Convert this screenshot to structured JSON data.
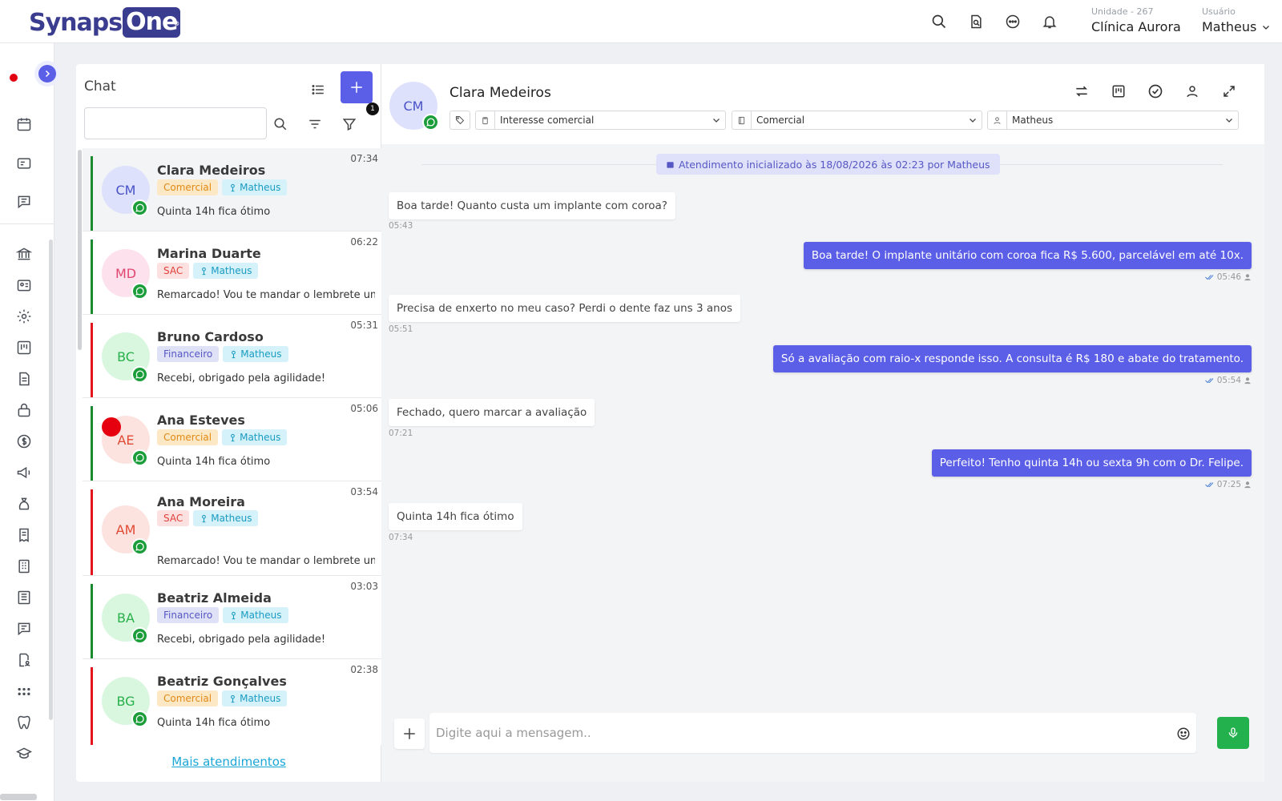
{
  "app": {
    "logo_part1": "Synaps",
    "logo_part2": "One",
    "logo_mark": "®"
  },
  "header": {
    "unit_label": "Unidade - 267",
    "unit_name": "Clínica Aurora",
    "user_label": "Usuário",
    "user_name": "Matheus"
  },
  "chat_list": {
    "title": "Chat",
    "filter_badge": "1",
    "search_value": "",
    "more_link": "Mais atendimentos",
    "items": [
      {
        "initials": "CM",
        "name": "Clara Medeiros",
        "time": "07:34",
        "tag1": "Comercial",
        "tag2": "Matheus",
        "preview": "Quinta 14h fica ótimo"
      },
      {
        "initials": "MD",
        "name": "Marina Duarte",
        "time": "06:22",
        "tag1": "SAC",
        "tag2": "Matheus",
        "preview": "Remarcado! Vou te mandar o lembrete um dia antes."
      },
      {
        "initials": "BC",
        "name": "Bruno Cardoso",
        "time": "05:31",
        "tag1": "Financeiro",
        "tag2": "Matheus",
        "preview": "Recebi, obrigado pela agilidade!"
      },
      {
        "initials": "AE",
        "name": "Ana Esteves",
        "time": "05:06",
        "tag1": "Comercial",
        "tag2": "Matheus",
        "preview": "Quinta 14h fica ótimo"
      },
      {
        "initials": "AM",
        "name": "Ana Moreira",
        "time": "03:54",
        "tag1": "SAC",
        "tag2": "Matheus",
        "preview": "Remarcado! Vou te mandar o lembrete um dia antes."
      },
      {
        "initials": "BA",
        "name": "Beatriz Almeida",
        "time": "03:03",
        "tag1": "Financeiro",
        "tag2": "Matheus",
        "preview": "Recebi, obrigado pela agilidade!"
      },
      {
        "initials": "BG",
        "name": "Beatriz Gonçalves",
        "time": "02:38",
        "tag1": "Comercial",
        "tag2": "Matheus",
        "preview": "Quinta 14h fica ótimo"
      }
    ]
  },
  "conversation": {
    "initials": "CM",
    "contact_name": "Clara Medeiros",
    "select_interest": "Interesse comercial",
    "select_sector": "Comercial",
    "select_user": "Matheus",
    "system_message": "Atendimento inicializado às 18/08/2026 às 02:23 por Matheus",
    "messages": [
      {
        "dir": "in",
        "text": "Boa tarde! Quanto custa um implante com coroa?",
        "time": "05:43"
      },
      {
        "dir": "out",
        "text": "Boa tarde! O implante unitário com coroa fica R$ 5.600, parcelável em até 10x.",
        "time": "05:46"
      },
      {
        "dir": "in",
        "text": "Precisa de enxerto no meu caso? Perdi o dente faz uns 3 anos",
        "time": "05:51"
      },
      {
        "dir": "out",
        "text": "Só a avaliação com raio-x responde isso. A consulta é R$ 180 e abate do tratamento.",
        "time": "05:54"
      },
      {
        "dir": "in",
        "text": "Fechado, quero marcar a avaliação",
        "time": "07:21"
      },
      {
        "dir": "out",
        "text": "Perfeito! Tenho quinta 14h ou sexta 9h com o Dr. Felipe.",
        "time": "07:25"
      },
      {
        "dir": "in",
        "text": "Quinta 14h fica ótimo",
        "time": "07:34"
      }
    ],
    "composer_placeholder": "Digite aqui a mensagem.."
  },
  "colors": {
    "accent": "#5b5ee6",
    "whatsapp": "#1b9d3a",
    "green_status": "#1a8a2e",
    "red_status": "#e3141c"
  }
}
